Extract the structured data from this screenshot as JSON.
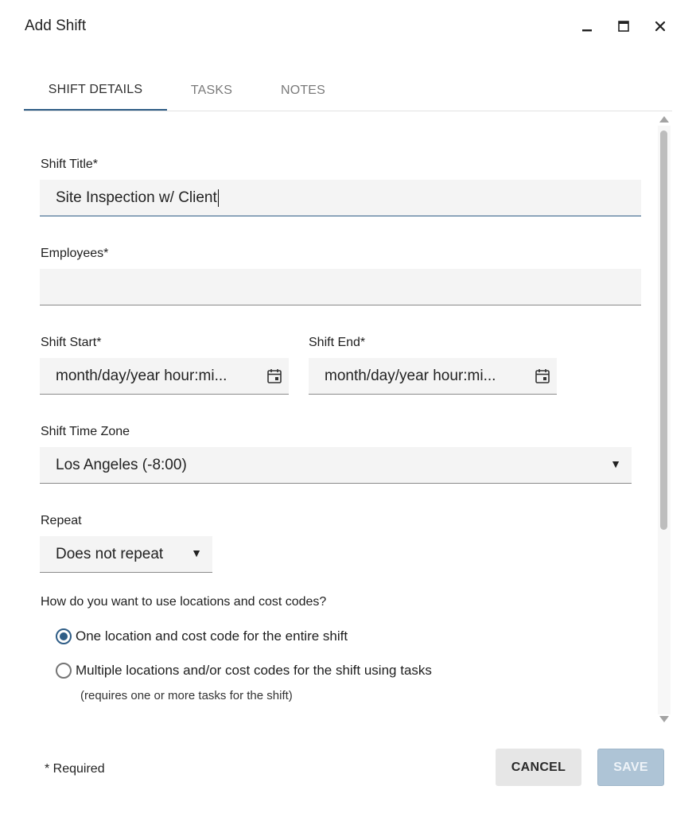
{
  "window": {
    "title": "Add Shift",
    "controls": {
      "minimize_icon": "minimize-icon",
      "maximize_icon": "maximize-icon",
      "close_icon": "close-icon"
    }
  },
  "tabs": [
    {
      "label": "SHIFT DETAILS",
      "active": true
    },
    {
      "label": "TASKS",
      "active": false
    },
    {
      "label": "NOTES",
      "active": false
    }
  ],
  "form": {
    "shift_title": {
      "label": "Shift Title*",
      "value": "Site Inspection w/ Client"
    },
    "employees": {
      "label": "Employees*",
      "value": ""
    },
    "shift_start": {
      "label": "Shift Start*",
      "placeholder": "month/day/year hour:mi..."
    },
    "shift_end": {
      "label": "Shift End*",
      "placeholder": "month/day/year hour:mi..."
    },
    "time_zone": {
      "label": "Shift Time Zone",
      "value": "Los Angeles (-8:00)"
    },
    "repeat": {
      "label": "Repeat",
      "value": "Does not repeat"
    },
    "location_question": "How do you want to use locations and cost codes?",
    "location_options": [
      {
        "label": "One location and cost code for the entire shift",
        "checked": true
      },
      {
        "label": "Multiple locations and/or cost codes for the shift using tasks",
        "checked": false
      }
    ],
    "location_note": "(requires one or more tasks for the shift)"
  },
  "footer": {
    "required_note": "* Required",
    "cancel_label": "CANCEL",
    "save_label": "SAVE"
  },
  "colors": {
    "accent": "#2f5d86",
    "save_disabled_bg": "#aec4d6",
    "field_bg": "#f4f4f4"
  }
}
